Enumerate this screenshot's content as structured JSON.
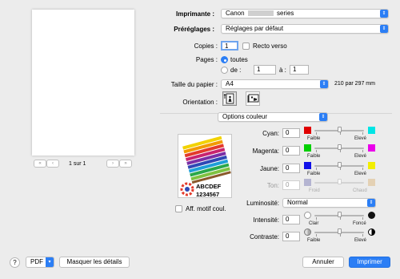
{
  "printer": {
    "label": "Imprimante :",
    "value": "Canon",
    "blurred": "██████",
    "suffix": "series"
  },
  "presets": {
    "label": "Préréglages :",
    "value": "Réglages par défaut"
  },
  "copies": {
    "label": "Copies :",
    "value": "1",
    "duplex_label": "Recto verso"
  },
  "pages": {
    "label": "Pages :",
    "all_label": "toutes",
    "from_label": "de :",
    "from_value": "1",
    "to_label": "à :",
    "to_value": "1"
  },
  "paper_size": {
    "label": "Taille du papier :",
    "value": "A4",
    "dimensions": "210 par 297 mm"
  },
  "orientation": {
    "label": "Orientation :"
  },
  "options_menu": {
    "value": "Options couleur"
  },
  "preview": {
    "page_counter": "1 sur 1",
    "show_pattern_label": "Aff. motif coul."
  },
  "color_sample": {
    "line1": "ABCDEF",
    "line2": "1234567"
  },
  "sliders": {
    "cyan": {
      "label": "Cyan:",
      "value": "0",
      "low": "Faible",
      "high": "Elevé",
      "color_low": "#e00000",
      "color_high": "#00e5e5",
      "level": 0.5
    },
    "magenta": {
      "label": "Magenta:",
      "value": "0",
      "low": "Faible",
      "high": "Elevé",
      "color_low": "#00d000",
      "color_high": "#ea00ea",
      "level": 0.5
    },
    "jaune": {
      "label": "Jaune:",
      "value": "0",
      "low": "Faible",
      "high": "Elevé",
      "color_low": "#1010e8",
      "color_high": "#f2ee00",
      "level": 0.5
    },
    "ton": {
      "label": "Ton:",
      "value": "0",
      "low": "Froid",
      "high": "Chaud",
      "color_low": "#9090c0",
      "color_high": "#e0c090",
      "level": 0.5,
      "disabled": true
    },
    "intensite": {
      "label": "Intensité:",
      "value": "0",
      "low": "Clair",
      "high": "Foncé",
      "level": 0.5
    },
    "contraste": {
      "label": "Contraste:",
      "value": "0",
      "low": "Faible",
      "high": "Elevé",
      "level": 0.5
    }
  },
  "luminosity": {
    "label": "Luminosité:",
    "value": "Normal"
  },
  "footer": {
    "help": "?",
    "pdf": "PDF",
    "hide_details": "Masquer les détails",
    "cancel": "Annuler",
    "print": "Imprimer"
  }
}
